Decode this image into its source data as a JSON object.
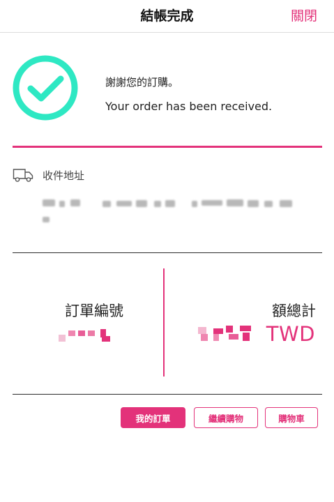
{
  "header": {
    "title": "結帳完成",
    "close_label": "關閉"
  },
  "confirmation": {
    "message_zh": "謝謝您的訂購。",
    "message_en": "Your order has been received."
  },
  "shipping": {
    "label": "收件地址"
  },
  "order": {
    "order_number_label": "訂單編號",
    "total_label": "額總計",
    "currency": "TWD"
  },
  "actions": {
    "my_orders_label": "我的訂單",
    "continue_shopping_label": "繼續購物",
    "cart_label": "購物車"
  },
  "colors": {
    "accent": "#e3327a",
    "success": "#2ee8c3"
  }
}
